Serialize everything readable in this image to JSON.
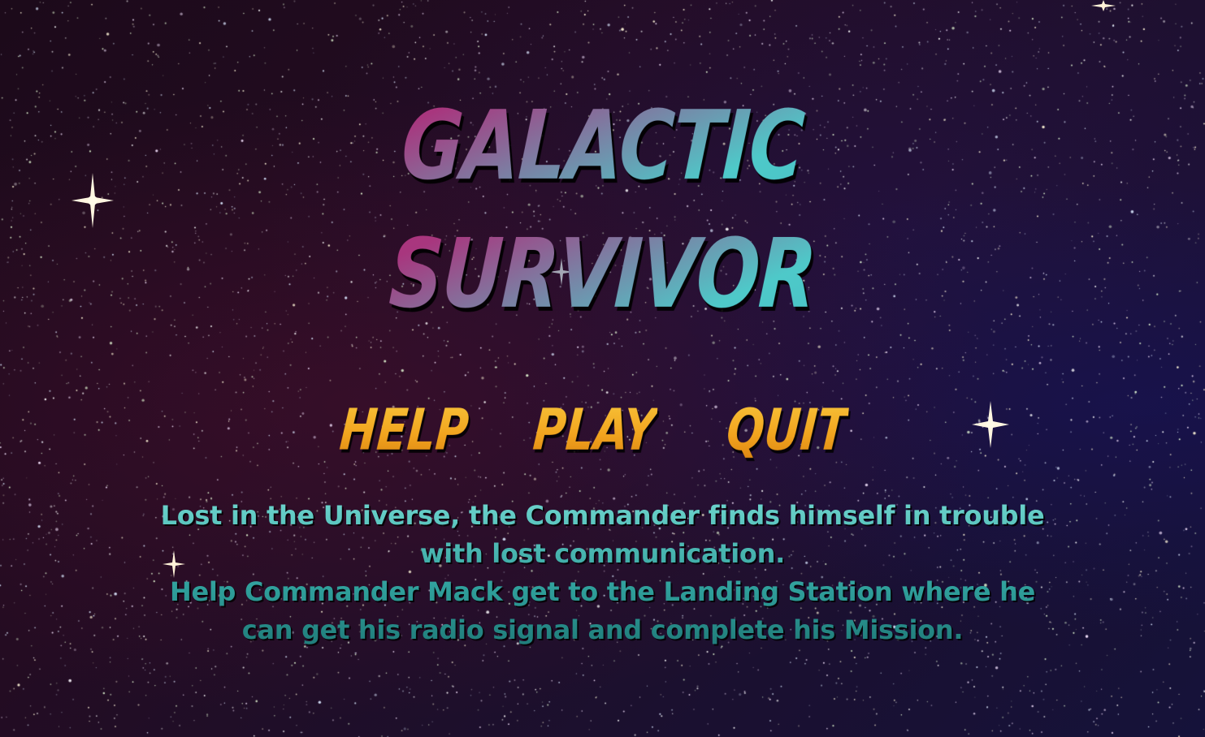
{
  "title": {
    "line1": "GALACTIC",
    "line2": "SURVIVOR"
  },
  "menu": {
    "help_label": "HELP",
    "play_label": "PLAY",
    "quit_label": "QUIT"
  },
  "story": {
    "paragraph1": "Lost in the Universe, the Commander finds himself in trouble with lost communication.",
    "paragraph2": "Help Commander Mack get to the Landing Station where he can get his radio signal and complete his Mission."
  },
  "colors": {
    "background_dark": "#1c0a1a",
    "title_pink": "#c2297a",
    "title_teal": "#4ec9c9",
    "menu_gold": "#f2a51f",
    "story_teal": "#2f9f9b"
  },
  "icons": {
    "sparkle": "four-point-star-sparkle-icon"
  }
}
